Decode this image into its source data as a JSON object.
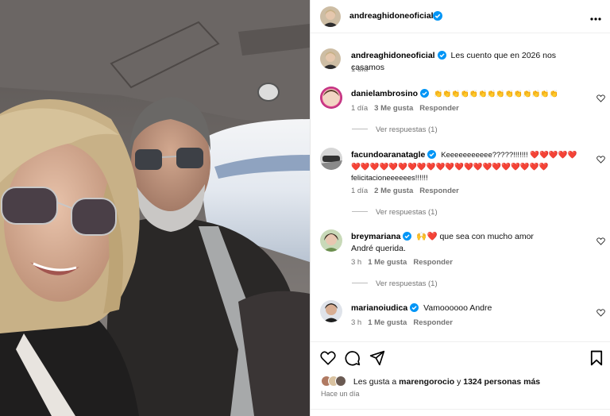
{
  "post": {
    "author": "andreaghidoneoficial",
    "caption_author": "andreaghidoneoficial",
    "caption": "Les cuento que en 2026 nos casamos",
    "caption_time": "1 día"
  },
  "comments": [
    {
      "user": "danielambrosino",
      "text": "👏👏👏👏👏👏👏👏👏👏👏👏👏👏",
      "time": "1 día",
      "likes": "3 Me gusta",
      "reply": "Responder",
      "view_replies": "Ver respuestas (1)"
    },
    {
      "user": "facundoaranatagle",
      "text": "Keeeeeeeeeee?????!!!!!!! ❤️❤️❤️❤️❤️❤️❤️❤️❤️❤️❤️❤️❤️❤️❤️❤️❤️❤️❤️❤️❤️❤️❤️❤️❤️❤️ felicitacioneeeeees!!!!!!",
      "time": "1 día",
      "likes": "2 Me gusta",
      "reply": "Responder",
      "view_replies": "Ver respuestas (1)"
    },
    {
      "user": "breymariana",
      "text": "🙌❤️ que sea con mucho amor André querida.",
      "time": "3 h",
      "likes": "1 Me gusta",
      "reply": "Responder",
      "view_replies": "Ver respuestas (1)"
    },
    {
      "user": "marianoiudica",
      "text": "Vamoooooo Andre",
      "time": "3 h",
      "likes": "1 Me gusta",
      "reply": "Responder"
    }
  ],
  "likes_line": {
    "prefix": "Les gusta a",
    "user": "marengorocio",
    "connector": "y",
    "others": "1324 personas más"
  },
  "post_time": "Hace un día",
  "icons": {
    "more": "more-options-icon",
    "verified": "verified-badge-icon",
    "like": "heart-outline-icon",
    "comment": "comment-bubble-icon",
    "share": "paper-plane-icon",
    "save": "bookmark-icon"
  },
  "colors": {
    "verified_blue": "#0095f6",
    "muted_text": "#737373"
  }
}
